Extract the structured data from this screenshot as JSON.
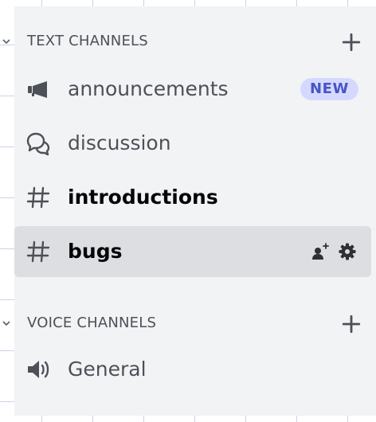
{
  "sidebar": {
    "text_category": {
      "label": "TEXT CHANNELS",
      "add_icon": "plus-icon",
      "chevron_icon": "chevron-down-icon"
    },
    "text_channels": [
      {
        "name": "announcements",
        "icon": "megaphone-icon",
        "badge": "NEW",
        "bold": false,
        "selected": false
      },
      {
        "name": "discussion",
        "icon": "forum-bubbles-icon",
        "bold": false,
        "selected": false
      },
      {
        "name": "introductions",
        "icon": "hash-icon",
        "bold": true,
        "selected": false
      },
      {
        "name": "bugs",
        "icon": "hash-icon",
        "bold": true,
        "selected": true,
        "actions": [
          "invite-user-icon",
          "gear-icon"
        ]
      }
    ],
    "voice_category": {
      "label": "VOICE CHANNELS",
      "add_icon": "plus-icon",
      "chevron_icon": "chevron-down-icon"
    },
    "voice_channels": [
      {
        "name": "General",
        "icon": "speaker-icon",
        "bold": false,
        "selected": false
      }
    ]
  },
  "colors": {
    "panel_bg": "#f2f3f5",
    "selected_bg": "#dddee1",
    "muted_text": "#4e5058",
    "strong_text": "#060607",
    "badge_bg": "#d5d9ff",
    "badge_text": "#4853c4"
  }
}
